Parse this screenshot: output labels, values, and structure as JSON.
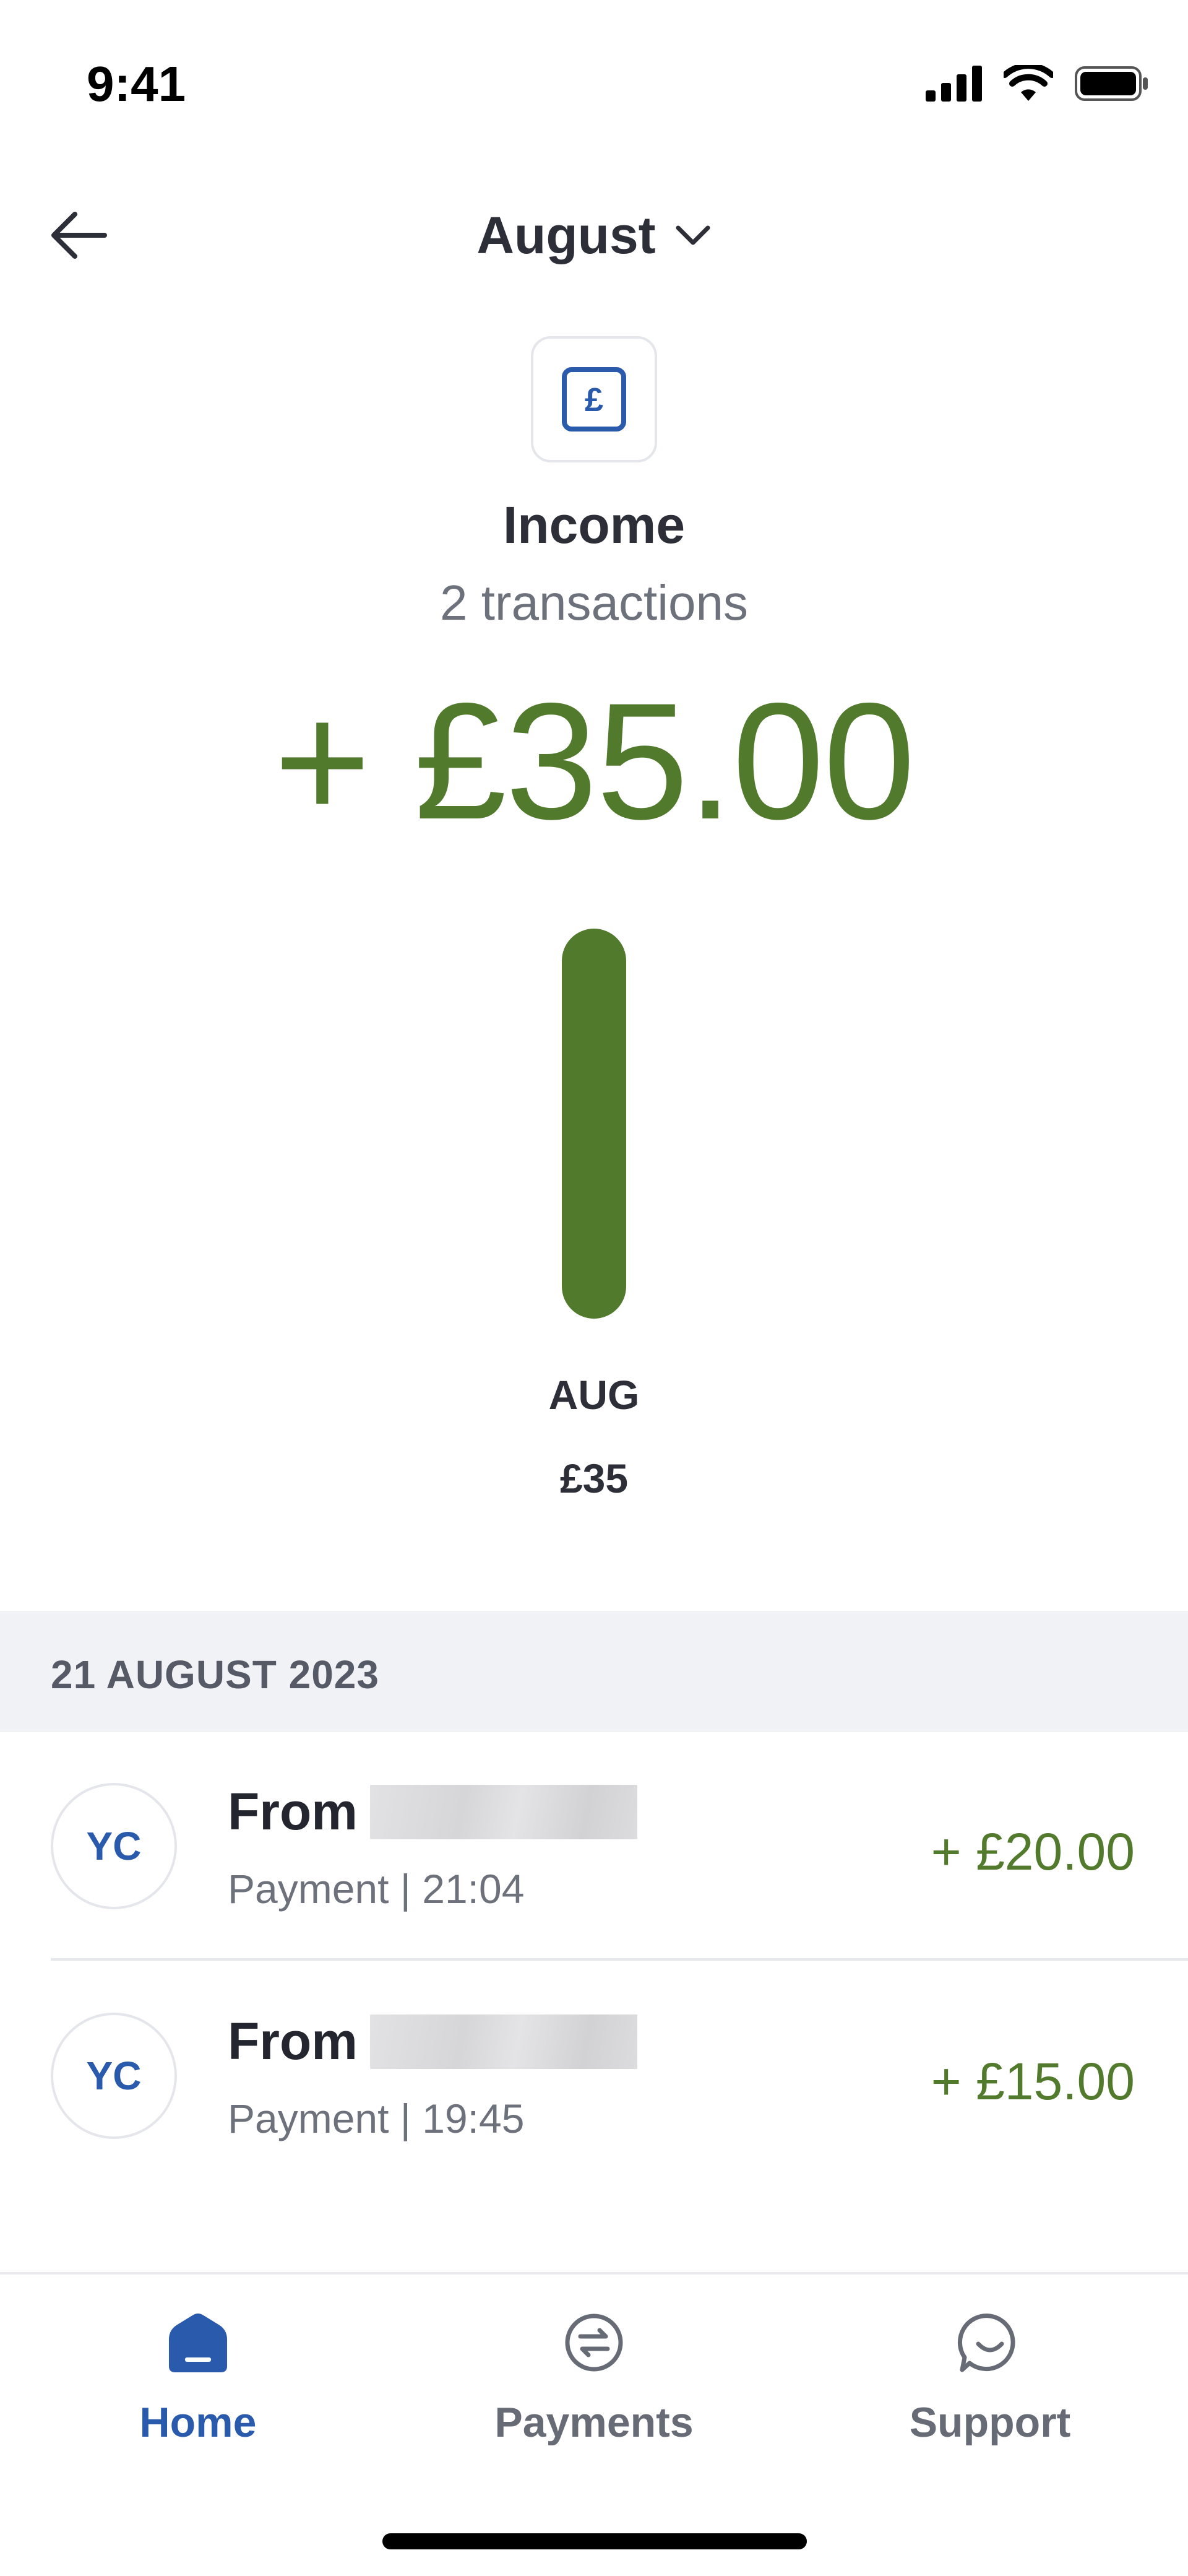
{
  "status_bar": {
    "time": "9:41"
  },
  "header": {
    "month": "August"
  },
  "summary": {
    "category_symbol": "£",
    "title": "Income",
    "transaction_count": "2 transactions",
    "total": "+ £35.00",
    "color_positive": "#527a2c"
  },
  "chart_data": {
    "type": "bar",
    "categories": [
      "AUG"
    ],
    "values": [
      35
    ],
    "value_labels": [
      "£35"
    ],
    "color": "#527a2c"
  },
  "transactions": {
    "date_header": "21 AUGUST 2023",
    "items": [
      {
        "initials": "YC",
        "title": "From",
        "subtitle": "Payment | 21:04",
        "amount": "+ £20.00"
      },
      {
        "initials": "YC",
        "title": "From",
        "subtitle": "Payment | 19:45",
        "amount": "+ £15.00"
      }
    ]
  },
  "nav": {
    "items": [
      {
        "label": "Home",
        "icon": "home-icon",
        "active": true
      },
      {
        "label": "Payments",
        "icon": "payments-icon",
        "active": false
      },
      {
        "label": "Support",
        "icon": "support-icon",
        "active": false
      }
    ],
    "accent": "#2a5aac"
  }
}
